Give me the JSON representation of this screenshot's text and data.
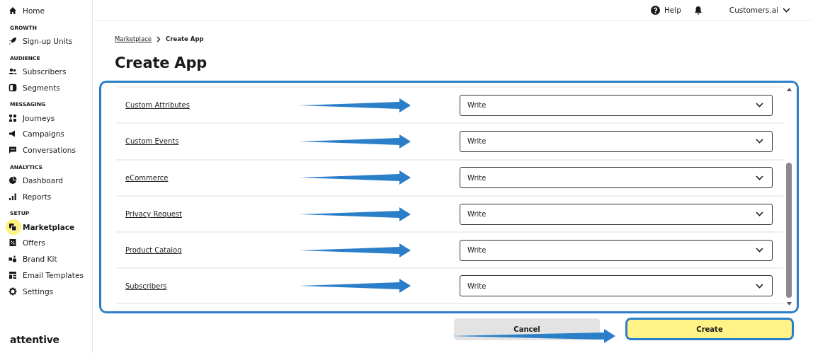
{
  "sidebar": {
    "home": {
      "label": "Home",
      "selected": false
    },
    "sections": [
      {
        "title": "GROWTH",
        "items": [
          {
            "label": "Sign-up Units",
            "selected": false
          }
        ]
      },
      {
        "title": "AUDIENCE",
        "items": [
          {
            "label": "Subscribers",
            "selected": false
          },
          {
            "label": "Segments",
            "selected": false
          }
        ]
      },
      {
        "title": "MESSAGING",
        "items": [
          {
            "label": "Journeys",
            "selected": false
          },
          {
            "label": "Campaigns",
            "selected": false
          },
          {
            "label": "Conversations",
            "selected": false
          }
        ]
      },
      {
        "title": "ANALYTICS",
        "items": [
          {
            "label": "Dashboard",
            "selected": false
          },
          {
            "label": "Reports",
            "selected": false
          }
        ]
      },
      {
        "title": "SETUP",
        "items": [
          {
            "label": "Marketplace",
            "selected": true
          },
          {
            "label": "Offers",
            "selected": false
          },
          {
            "label": "Brand Kit",
            "selected": false
          },
          {
            "label": "Email Templates",
            "selected": false
          },
          {
            "label": "Settings",
            "selected": false
          }
        ]
      }
    ],
    "logo": "attentive"
  },
  "top_bar": {
    "help": "Help",
    "account": "Customers.ai"
  },
  "breadcrumb": [
    {
      "label": "Marketplace",
      "kind": "link"
    },
    {
      "label": "Create App",
      "kind": "current"
    }
  ],
  "title": "Create App",
  "permissions_panel": {
    "highlighted": true,
    "rows": [
      {
        "label": "Custom Attributes",
        "value": "Write",
        "arrow": true
      },
      {
        "label": "Custom Events",
        "value": "Write",
        "arrow": true
      },
      {
        "label": "eCommerce",
        "value": "Write",
        "arrow": true
      },
      {
        "label": "Privacy Request",
        "value": "Write",
        "arrow": true
      },
      {
        "label": "Product Catalog",
        "value": "Write",
        "arrow": true
      },
      {
        "label": "Subscribers",
        "value": "Write",
        "arrow": true
      }
    ]
  },
  "buttons": [
    {
      "label": "Cancel",
      "kind": "secondary",
      "arrow": true,
      "highlighted": false
    },
    {
      "label": "Create",
      "kind": "primary",
      "arrow": false,
      "highlighted": true
    }
  ]
}
